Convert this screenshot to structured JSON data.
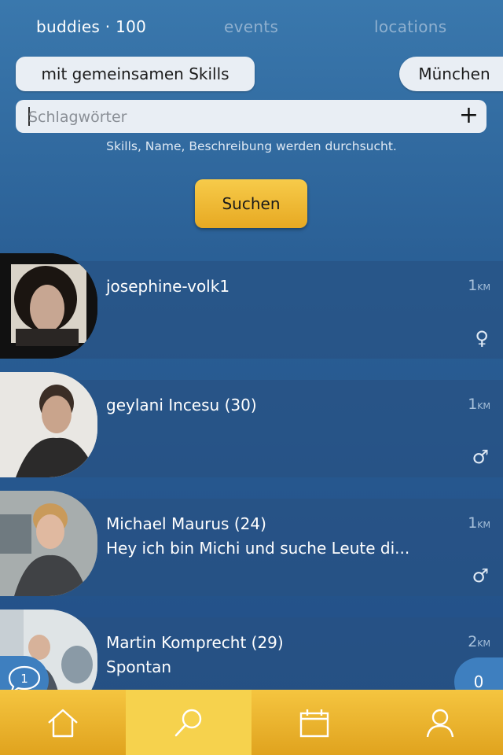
{
  "tabs": {
    "buddies": "buddies · 100",
    "events": "events",
    "locations": "locations"
  },
  "filters": {
    "skills_chip": "mit gemeinsamen Skills",
    "city_chip": "München"
  },
  "search": {
    "placeholder": "Schlagwörter",
    "add_icon": "plus-icon",
    "hint": "Skills, Name, Beschreibung werden durchsucht.",
    "button_label": "Suchen"
  },
  "results": [
    {
      "name": "josephine-volk1",
      "description": "",
      "distance": "1",
      "unit": "KM",
      "gender_symbol": "♀"
    },
    {
      "name": "geylani Incesu (30)",
      "description": "",
      "distance": "1",
      "unit": "KM",
      "gender_symbol": "♂"
    },
    {
      "name": "Michael Maurus (24)",
      "description": "Hey ich bin Michi und suche Leute di...",
      "distance": "1",
      "unit": "KM",
      "gender_symbol": "♂"
    },
    {
      "name": "Martin Komprecht (29)",
      "description": "Spontan",
      "distance": "2",
      "unit": "KM",
      "gender_symbol": ""
    }
  ],
  "chat": {
    "count": "1"
  },
  "notifications": {
    "count": "0"
  },
  "nav": {
    "items": [
      "home-icon",
      "search-icon",
      "calendar-icon",
      "profile-icon"
    ],
    "active": "search-icon"
  },
  "colors": {
    "background": "#2a5f95",
    "accent": "#f0b935",
    "card": "#2b5585"
  }
}
